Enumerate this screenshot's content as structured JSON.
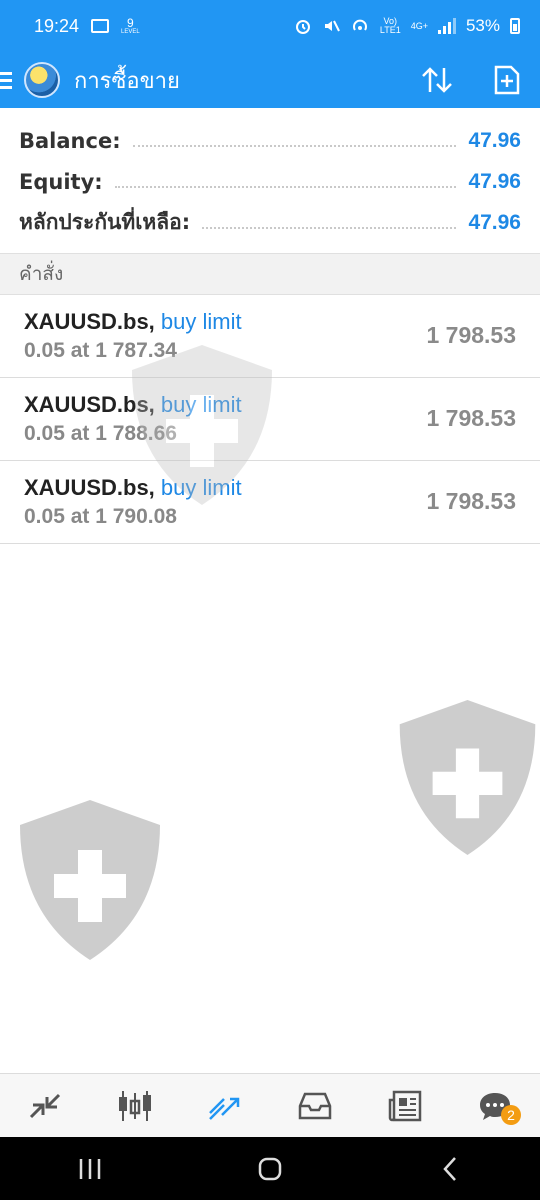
{
  "status_bar": {
    "time": "19:24",
    "notif_number": "9",
    "notif_sub": "LEVEL",
    "network_label_1": "Vo)",
    "network_label_2": "LTE1",
    "network_label_3": "4G+",
    "battery": "53%"
  },
  "app_bar": {
    "title": "การซื้อขาย",
    "icons": [
      "menu-icon",
      "app-logo",
      "sort-icon",
      "new-order-icon"
    ]
  },
  "summary": {
    "balance_label": "Balance:",
    "balance_value": "47.96",
    "equity_label": "Equity:",
    "equity_value": "47.96",
    "margin_label": "หลักประกันที่เหลือ:",
    "margin_value": "47.96"
  },
  "orders_header": "คำสั่ง",
  "orders": [
    {
      "symbol": "XAUUSD.bs,",
      "type": "buy limit",
      "detail": "0.05 at 1 787.34",
      "price": "1 798.53"
    },
    {
      "symbol": "XAUUSD.bs,",
      "type": "buy limit",
      "detail": "0.05 at 1 788.66",
      "price": "1 798.53"
    },
    {
      "symbol": "XAUUSD.bs,",
      "type": "buy limit",
      "detail": "0.05 at 1 790.08",
      "price": "1 798.53"
    }
  ],
  "bottom_nav": {
    "items": [
      "quotes-icon",
      "chart-icon",
      "trade-icon",
      "history-icon",
      "news-icon",
      "chat-icon"
    ],
    "active": "trade-icon",
    "chat_badge": "2"
  },
  "colors": {
    "accent": "#2196f3",
    "value_blue": "#1e88e5",
    "badge": "#f39c12"
  }
}
